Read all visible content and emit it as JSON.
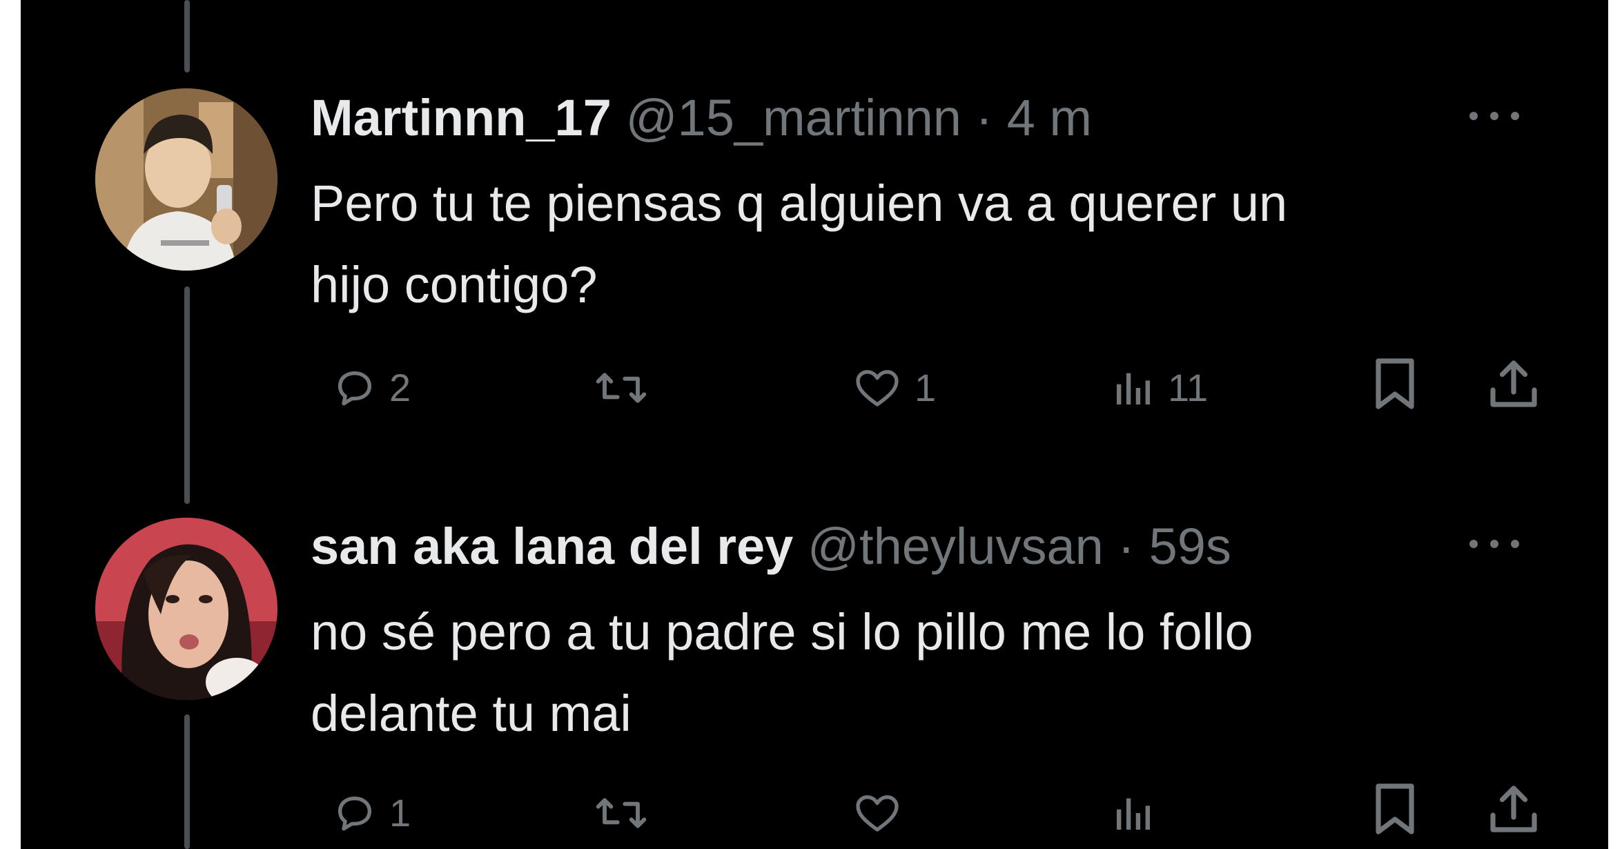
{
  "tweets": [
    {
      "display_name": "Martinnn_17",
      "handle": "@15_martinnn",
      "separator": "·",
      "time": "4 m",
      "text_line1": "Pero tu te piensas q alguien va a querer un",
      "text_line2": "hijo contigo?",
      "avatar_icon": "avatar-boy-selfie",
      "actions": {
        "reply_count": "2",
        "retweet_count": "",
        "like_count": "1",
        "views_count": "11"
      }
    },
    {
      "display_name": "san aka lana del rey",
      "handle": "@theyluvsan",
      "separator": "·",
      "time": "59s",
      "text_line1": "no sé pero a tu padre si lo pillo me lo follo",
      "text_line2": "delante tu mai",
      "avatar_icon": "avatar-girl-selfie",
      "actions": {
        "reply_count": "1",
        "retweet_count": "",
        "like_count": "",
        "views_count": ""
      }
    }
  ],
  "icons": {
    "reply": "reply-bubble-icon",
    "retweet": "retweet-icon",
    "like": "heart-icon",
    "views": "views-bars-icon",
    "bookmark": "bookmark-icon",
    "share": "share-upload-icon",
    "more": "more-dots-icon"
  },
  "colors": {
    "background": "#000000",
    "primary_text": "#e7e9ea",
    "secondary_text": "#71767b",
    "thread_line": "#4a4f54"
  }
}
